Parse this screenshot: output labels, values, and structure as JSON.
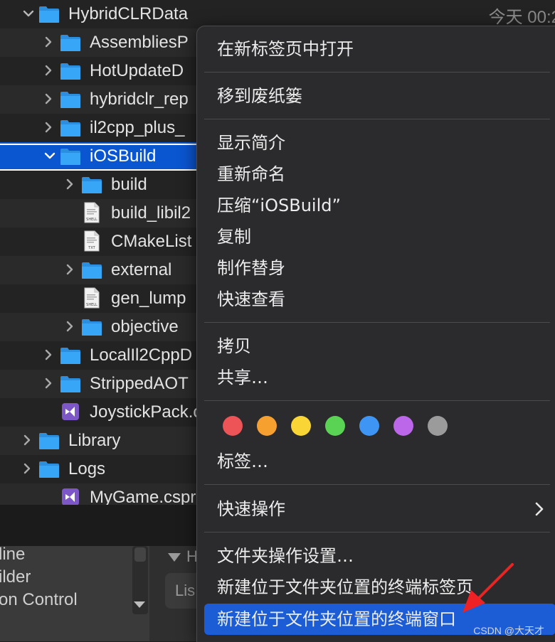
{
  "finder": {
    "date": "今天 00:2",
    "rows": [
      {
        "name": "HybridCLRData",
        "type": "folder",
        "indent": 0,
        "expanded": true
      },
      {
        "name": "AssembliesP",
        "type": "folder",
        "indent": 1,
        "expanded": false
      },
      {
        "name": "HotUpdateD",
        "type": "folder",
        "indent": 1,
        "expanded": false
      },
      {
        "name": "hybridclr_rep",
        "type": "folder",
        "indent": 1,
        "expanded": false
      },
      {
        "name": "il2cpp_plus_",
        "type": "folder",
        "indent": 1,
        "expanded": false
      },
      {
        "name": "iOSBuild",
        "type": "folder",
        "indent": 1,
        "expanded": true,
        "selected": true
      },
      {
        "name": "build",
        "type": "folder",
        "indent": 2,
        "expanded": false
      },
      {
        "name": "build_libil2",
        "type": "shell",
        "indent": 2
      },
      {
        "name": "CMakeList",
        "type": "txt",
        "indent": 2
      },
      {
        "name": "external",
        "type": "folder",
        "indent": 2,
        "expanded": false
      },
      {
        "name": "gen_lump",
        "type": "shell",
        "indent": 2
      },
      {
        "name": "objective",
        "type": "folder",
        "indent": 2,
        "expanded": false
      },
      {
        "name": "LocalIl2CppD",
        "type": "folder",
        "indent": 1,
        "expanded": false
      },
      {
        "name": "StrippedAOT",
        "type": "folder",
        "indent": 1,
        "expanded": false
      },
      {
        "name": "JoystickPack.c",
        "type": "vs",
        "indent": 1
      },
      {
        "name": "Library",
        "type": "folder",
        "indent": 0,
        "expanded": false
      },
      {
        "name": "Logs",
        "type": "folder",
        "indent": 0,
        "expanded": false
      },
      {
        "name": "MyGame.cspro",
        "type": "vs",
        "indent": 1
      }
    ]
  },
  "file_badges": {
    "shell": "SHELL",
    "txt": "TXT"
  },
  "bottom": {
    "side_items": [
      "line",
      "ilder",
      "on Control"
    ],
    "ghost_header": "H",
    "ghost_box": "Lis"
  },
  "menu": {
    "open_new_tab": "在新标签页中打开",
    "move_to_trash": "移到废纸篓",
    "get_info": "显示简介",
    "rename": "重新命名",
    "compress": "压缩“iOSBuild”",
    "copy": "复制",
    "make_alias": "制作替身",
    "quick_look": "快速查看",
    "copy2": "拷贝",
    "share": "共享…",
    "tags": "标签…",
    "quick_actions": "快速操作",
    "folder_action_setup": "文件夹操作设置…",
    "new_terminal_tab": "新建位于文件夹位置的终端标签页",
    "new_terminal_window": "新建位于文件夹位置的终端窗口",
    "tag_colors": [
      "#ec5457",
      "#f5a02f",
      "#f9d535",
      "#5ad354",
      "#3f95f3",
      "#bc66ea",
      "#9b9b9c"
    ]
  },
  "watermark": "CSDN @大天才",
  "colors": {
    "selection": "#0a56d0",
    "highlight": "#1c5cd4",
    "folder": "#2d9ff0",
    "arrow": "#ee2124"
  }
}
